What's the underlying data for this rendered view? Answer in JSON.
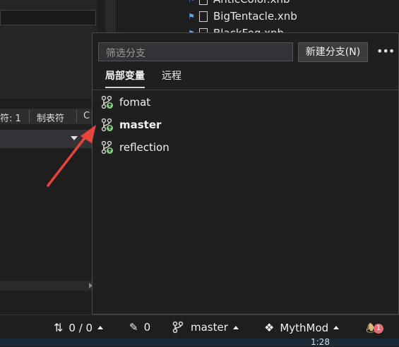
{
  "background": {
    "status_fields": [
      "符: 1",
      "制表符",
      "C"
    ],
    "files": [
      "AnticColor.xnb",
      "BigTentacle.xnb",
      "BlackFog.xnb"
    ]
  },
  "popup": {
    "filter_placeholder": "筛选分支",
    "new_branch_label": "新建分支(N)",
    "more_label": "•••",
    "tabs": [
      {
        "label": "局部变量",
        "active": true
      },
      {
        "label": "远程",
        "active": false
      }
    ],
    "branches": [
      {
        "name": "fomat",
        "current": false
      },
      {
        "name": "master",
        "current": true
      },
      {
        "name": "reflection",
        "current": false
      }
    ],
    "branch_icon": "git-branch-icon",
    "branch_icon_color": "#89d185"
  },
  "statusbar": {
    "sync_label": "0 / 0",
    "pending_label": "0",
    "branch_label": "master",
    "repo_label": "MythMod",
    "notification_count": "1",
    "time": "1:28"
  },
  "annotation": {
    "arrow_color": "#e8443a"
  }
}
